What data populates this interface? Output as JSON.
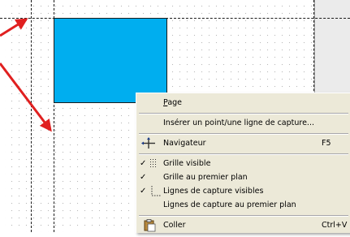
{
  "menu": {
    "items": [
      {
        "label": "Page",
        "shortcut": "",
        "checked": false,
        "icon": ""
      },
      {
        "label": "Insérer un point/une ligne de capture...",
        "shortcut": "",
        "checked": false,
        "icon": ""
      },
      {
        "label": "Navigateur",
        "shortcut": "F5",
        "checked": false,
        "icon": "navigator-icon"
      },
      {
        "label": "Grille visible",
        "shortcut": "",
        "checked": true,
        "icon": "grid-icon"
      },
      {
        "label": "Grille au premier plan",
        "shortcut": "",
        "checked": true,
        "icon": ""
      },
      {
        "label": "Lignes de capture visibles",
        "shortcut": "",
        "checked": true,
        "icon": "snap-lines-icon"
      },
      {
        "label": "Lignes de capture au premier plan",
        "shortcut": "",
        "checked": false,
        "icon": ""
      },
      {
        "label": "Coller",
        "shortcut": "Ctrl+V",
        "checked": false,
        "icon": "paste-icon"
      }
    ],
    "check_glyph": "✓"
  },
  "canvas": {
    "shape_color": "#00aeef",
    "arrow_color": "#e02020",
    "guide_color": "#1a1a1a"
  }
}
